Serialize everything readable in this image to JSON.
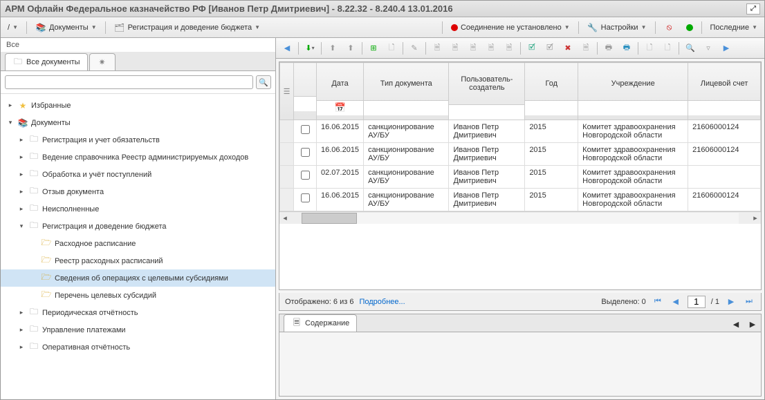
{
  "title": "АРМ Офлайн Федеральное казначейство РФ [Иванов Петр Дмитриевич] - 8.22.32 - 8.240.4 13.01.2016",
  "toolbar": {
    "empty_dd": "/",
    "documents": "Документы",
    "registration": "Регистрация и доведение бюджета",
    "connection": "Соединение не установлено",
    "settings": "Настройки",
    "recent": "Последние"
  },
  "sidebar": {
    "all_label": "Все",
    "tab_all": "Все документы",
    "tree": {
      "favorites": "Избранные",
      "documents": "Документы",
      "reg_accounting": "Регистрация и учет обязательств",
      "ref_registry": "Ведение справочника Реестр администрируемых доходов",
      "processing": "Обработка и учёт поступлений",
      "recall": "Отзыв документа",
      "unexecuted": "Неисполненные",
      "reg_budget": "Регистрация и доведение бюджета",
      "expense_schedule": "Расходное расписание",
      "registry_schedules": "Реестр расходных расписаний",
      "target_subsidies": "Сведения об операциях с целевыми субсидиями",
      "subsidies_list": "Перечень целевых субсидий",
      "periodic_reports": "Периодическая отчётность",
      "payment_mgmt": "Управление платежами",
      "operative_reports": "Оперативная отчётность"
    }
  },
  "grid": {
    "headers": {
      "date": "Дата",
      "doctype": "Тип документа",
      "creator": "Пользователь-создатель",
      "year": "Год",
      "institution": "Учреждение",
      "account": "Лицевой счет"
    },
    "rows": [
      {
        "date": "16.06.2015",
        "doctype": "санкционирование АУ/БУ",
        "creator": "Иванов Петр Дмитриевич",
        "year": "2015",
        "institution": "Комитет здравоохранения Новгородской области",
        "account": "21606000124"
      },
      {
        "date": "16.06.2015",
        "doctype": "санкционирование АУ/БУ",
        "creator": "Иванов Петр Дмитриевич",
        "year": "2015",
        "institution": "Комитет здравоохранения Новгородской области",
        "account": "21606000124"
      },
      {
        "date": "02.07.2015",
        "doctype": "санкционирование АУ/БУ",
        "creator": "Иванов Петр Дмитриевич",
        "year": "2015",
        "institution": "Комитет здравоохранения Новгородской области",
        "account": ""
      },
      {
        "date": "16.06.2015",
        "doctype": "санкционирование АУ/БУ",
        "creator": "Иванов Петр Дмитриевич",
        "year": "2015",
        "institution": "Комитет здравоохранения Новгородской области",
        "account": "21606000124"
      }
    ]
  },
  "status": {
    "shown": "Отображено: 6 из 6",
    "more": "Подробнее...",
    "selected": "Выделено: 0",
    "page": "1",
    "pages": "/ 1"
  },
  "detail": {
    "tab": "Содержание"
  }
}
